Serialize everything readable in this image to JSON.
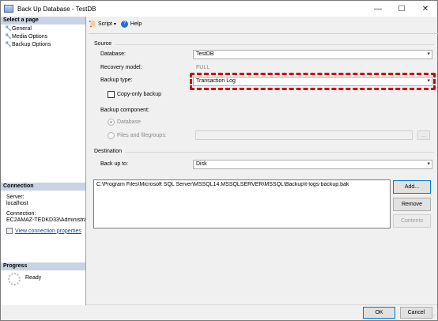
{
  "window": {
    "title": "Back Up Database - TestDB",
    "minimize_glyph": "—",
    "maximize_glyph": "☐",
    "close_glyph": "✕"
  },
  "left": {
    "select_page_header": "Select a page",
    "pages": [
      "General",
      "Media Options",
      "Backup Options"
    ],
    "connection_header": "Connection",
    "server_label": "Server:",
    "server_value": "localhost",
    "connection_label": "Connection:",
    "connection_value": "EC2AMAZ-TEDKD33\\Administrator",
    "view_props_link": "View connection properties",
    "progress_header": "Progress",
    "progress_status": "Ready"
  },
  "toolbar": {
    "script_label": "Script",
    "help_label": "Help"
  },
  "source": {
    "header": "Source",
    "database_label": "Database:",
    "database_value": "TestDB",
    "recovery_label": "Recovery model:",
    "recovery_value": "FULL",
    "backup_type_label": "Backup type:",
    "backup_type_value": "Transaction Log",
    "copy_only_label": "Copy-only backup",
    "copy_only_checked": false,
    "component_label": "Backup component:",
    "component_database": "Database",
    "component_files": "Files and filegroups:",
    "files_browse": "..."
  },
  "destination": {
    "header": "Destination",
    "backup_to_label": "Back up to:",
    "backup_to_value": "Disk",
    "paths": [
      "C:\\Program Files\\Microsoft SQL Server\\MSSQL14.MSSQLSERVER\\MSSQL\\Backup\\t-logs-backup.bak"
    ],
    "add_button": "Add...",
    "remove_button": "Remove",
    "contents_button": "Contents"
  },
  "footer": {
    "ok_button": "OK",
    "cancel_button": "Cancel"
  },
  "colors": {
    "highlight": "#d00000",
    "section_header_bg": "#c9d3e4",
    "link": "#0645ad"
  }
}
